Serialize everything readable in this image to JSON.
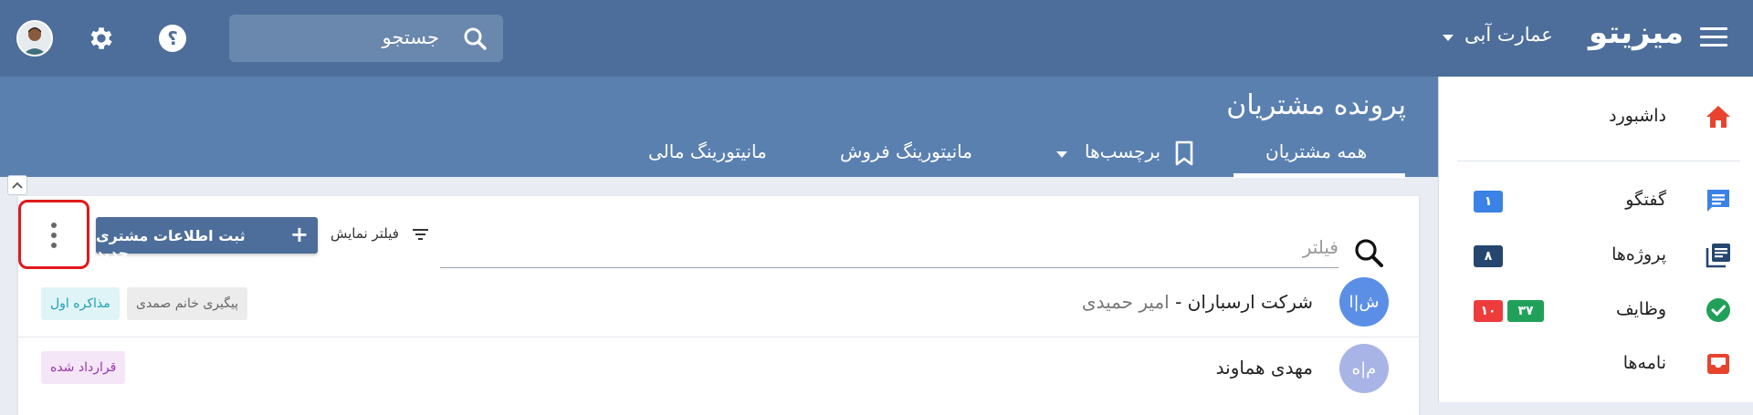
{
  "app": {
    "logo": "میزیتو",
    "org": "عمارت آبی"
  },
  "topbar": {
    "search_label": "جستجو"
  },
  "sidebar": {
    "items": [
      {
        "label": "داشبورد"
      },
      {
        "label": "گفتگو",
        "badge": "۱"
      },
      {
        "label": "پروژه‌ها",
        "badge": "۸"
      },
      {
        "label": "وظایف",
        "badge_green": "۳۷",
        "badge_red": "۱۰"
      },
      {
        "label": "نامه‌ها"
      }
    ]
  },
  "page": {
    "title": "پرونده مشتریان"
  },
  "tabs": [
    {
      "label": "همه مشتریان"
    },
    {
      "label": "برچسب‌ها"
    },
    {
      "label": "مانیتورینگ فروش"
    },
    {
      "label": "مانیتورینگ مالی"
    }
  ],
  "toolbar": {
    "new_button": "ثبت اطلاعات مشتری جدید",
    "filter_toggle": "فیلتر نمایش",
    "filter_placeholder": "فیلتر"
  },
  "customers": [
    {
      "avatar": "ش|ا",
      "name": "شرکت ارسباران",
      "separator": " - ",
      "contact": "امیر حمیدی",
      "tags": [
        "پیگیری خانم صمدی",
        "مذاکره اول"
      ]
    },
    {
      "avatar": "م|ه",
      "name": "مهدی هماوند",
      "tags": [
        "قرارداد شده"
      ]
    }
  ],
  "colors": {
    "topbar": "#4d6e9a",
    "band": "#5a80b0",
    "accent_red": "#e8432e",
    "badge_blue": "#3b82e6",
    "badge_navy": "#24466f",
    "badge_green": "#21a05a",
    "badge_red": "#ee3b3b"
  }
}
